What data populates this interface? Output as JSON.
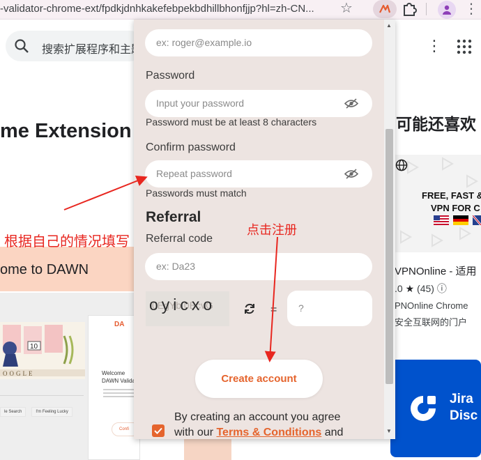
{
  "browser": {
    "url": "-validator-chrome-ext/fpdkjdnhkakefebpekbdhillbhonfjjp?hl=zh-CN..."
  },
  "store": {
    "search_placeholder": "搜索扩展程序和主题",
    "extension_title": "me Extension",
    "you_may_like": "可能还喜欢",
    "promo_text": "ome to DAWN",
    "preview": {
      "logo": "DA",
      "welcome_line1": "Welcome",
      "welcome_line2": "DAWN Validat",
      "btn": "Confi",
      "search_btn": "le Search",
      "lucky_btn": "I'm Feeling Lucky"
    },
    "vpn_card": {
      "banner_line1": "FREE, FAST &",
      "banner_line2": "VPN FOR C",
      "name": "VPNOnline - 适用",
      "rating": ".0",
      "reviews": "(45)",
      "desc1": "PNOnline Chrome",
      "desc2": "安全互联网的门户"
    },
    "jira_card": {
      "line1": "Jira",
      "line2": "Disc"
    }
  },
  "annotations": {
    "fill_in": "根据自己的情况填写",
    "click_register": "点击注册"
  },
  "popup": {
    "email_placeholder": "ex: roger@example.io",
    "password_label": "Password",
    "password_placeholder": "Input your password",
    "password_hint": "Password must be at least 8 characters",
    "confirm_label": "Confirm password",
    "confirm_placeholder": "Repeat password",
    "confirm_hint": "Passwords must match",
    "referral_title": "Referral",
    "referral_label": "Referral code",
    "referral_placeholder": "ex: Da23",
    "captcha_text": "oyicxo",
    "captcha_noise": "0EgYb  0BcvG",
    "equals": "=",
    "answer_placeholder": "?",
    "create_button": "Create account",
    "agree_line1": "By creating an account you agree",
    "agree_prefix": "with our ",
    "terms_link": "Terms & Conditions",
    "agree_suffix": " and"
  },
  "colors": {
    "accent": "#e5642d",
    "popup_bg": "#ede4e1",
    "annotation": "#e8261f"
  }
}
